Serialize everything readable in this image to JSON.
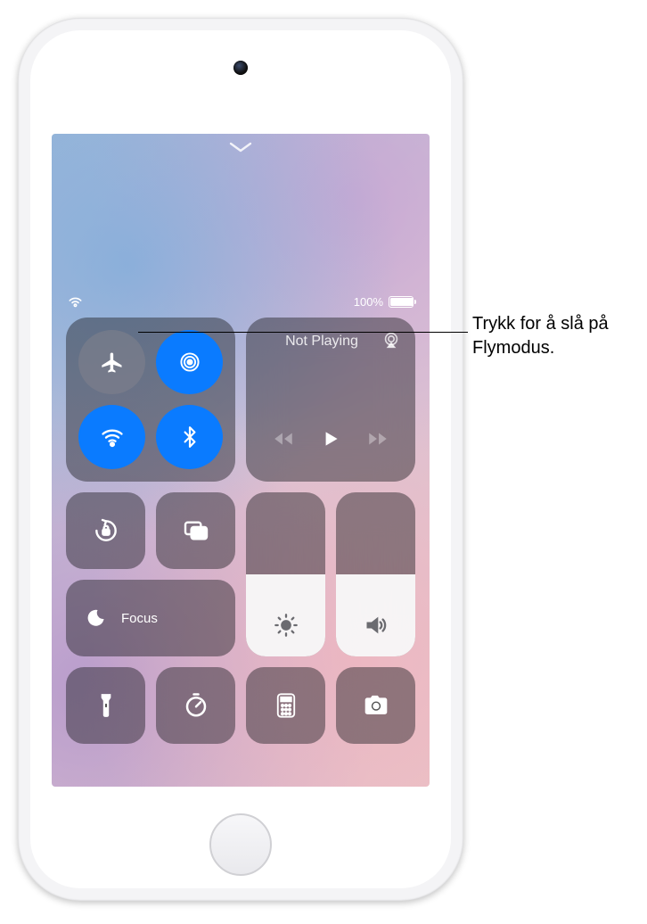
{
  "status": {
    "battery_pct": "100%",
    "battery_fill_pct": 100
  },
  "media": {
    "now_playing": "Not Playing"
  },
  "focus": {
    "label": "Focus"
  },
  "sliders": {
    "brightness_pct": 50,
    "volume_pct": 50
  },
  "connectivity": {
    "airplane_on": false,
    "airdrop_on": true,
    "wifi_on": true,
    "bluetooth_on": true
  },
  "callout": {
    "text": "Trykk for å slå på Flymodus."
  }
}
